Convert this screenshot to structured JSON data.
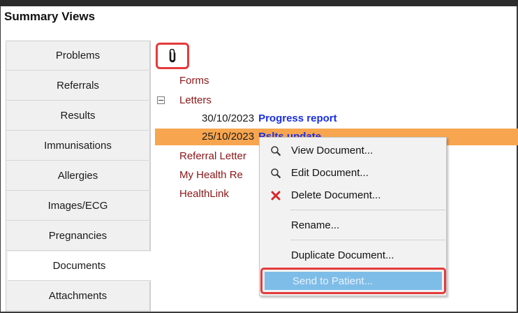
{
  "title": "Summary Views",
  "sidebar": {
    "items": [
      {
        "label": "Problems"
      },
      {
        "label": "Referrals"
      },
      {
        "label": "Results"
      },
      {
        "label": "Immunisations"
      },
      {
        "label": "Allergies"
      },
      {
        "label": "Images/ECG"
      },
      {
        "label": "Pregnancies"
      },
      {
        "label": "Documents",
        "active": true
      },
      {
        "label": "Attachments"
      }
    ]
  },
  "toolbar": {
    "attach_icon": "paperclip-icon"
  },
  "tree": {
    "forms": "Forms",
    "letters": "Letters",
    "documents": [
      {
        "date": "30/10/2023",
        "title": "Progress report"
      },
      {
        "date": "25/10/2023",
        "title": "Rslts update",
        "selected": true
      }
    ],
    "referral_letters": "Referral Letter",
    "my_health_record": "My Health Re",
    "healthlink": "HealthLink"
  },
  "context_menu": {
    "view": "View Document...",
    "edit": "Edit Document...",
    "delete": "Delete Document...",
    "rename": "Rename...",
    "duplicate": "Duplicate Document...",
    "send": "Send to Patient..."
  },
  "colors": {
    "highlight": "#e53b3b",
    "selected_row": "#f7a64f",
    "link_blue": "#1a2fe6",
    "folder_text": "#8b1616",
    "menu_hover": "#7fbde9"
  }
}
